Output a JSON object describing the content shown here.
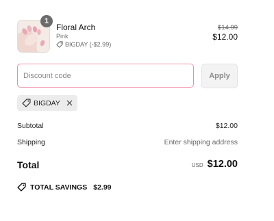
{
  "product": {
    "quantity": "1",
    "name": "Floral Arch",
    "variant": "Pink",
    "discount_line": "BIGDAY (-$2.99)",
    "original_price": "$14.99",
    "price": "$12.00"
  },
  "discount": {
    "placeholder": "Discount code",
    "apply_label": "Apply",
    "applied_code": "BIGDAY"
  },
  "summary": {
    "subtotal_label": "Subtotal",
    "subtotal_value": "$12.00",
    "shipping_label": "Shipping",
    "shipping_value": "Enter shipping address",
    "total_label": "Total",
    "currency": "USD",
    "total_value": "$12.00",
    "savings_label": "TOTAL SAVINGS",
    "savings_value": "$2.99"
  },
  "colors": {
    "input_border": "#f08ca7",
    "apply_bg": "#f3f3f3",
    "chip_bg": "#ececec",
    "badge_bg": "#6b6b6b"
  },
  "icons": {
    "discount_tag": "tag-icon",
    "remove_code": "close-icon",
    "savings": "tag-icon"
  }
}
